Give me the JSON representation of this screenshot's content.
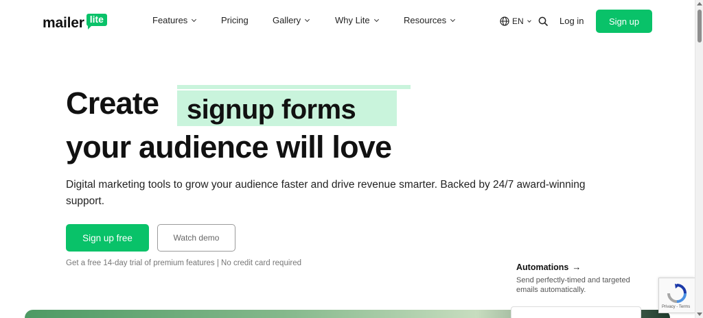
{
  "brand": {
    "wordmark": "mailer",
    "badge": "lite",
    "accent_color": "#09c269",
    "highlight_color": "#c9f4dc"
  },
  "nav": {
    "items": [
      {
        "label": "Features",
        "has_dropdown": true
      },
      {
        "label": "Pricing",
        "has_dropdown": false
      },
      {
        "label": "Gallery",
        "has_dropdown": true
      },
      {
        "label": "Why Lite",
        "has_dropdown": true
      },
      {
        "label": "Resources",
        "has_dropdown": true
      }
    ],
    "language": "EN",
    "globe_icon": "globe-icon",
    "search_icon": "search-icon",
    "login_label": "Log in",
    "signup_label": "Sign up"
  },
  "hero": {
    "line1": "Create",
    "rotating_word": "signup forms",
    "line2": "your audience will love",
    "subtitle": "Digital marketing tools to grow your audience faster and drive revenue smarter. Backed by 24/7 award-winning support.",
    "primary_cta": "Sign up free",
    "secondary_cta": "Watch demo",
    "trial_note": "Get a free 14-day trial of premium features | No credit card required"
  },
  "feature_card": {
    "title": "Automations",
    "arrow": "→",
    "description": "Send perfectly-timed and targeted emails automatically."
  },
  "recaptcha": {
    "terms": "Privacy - Terms",
    "icon": "recaptcha-icon"
  }
}
